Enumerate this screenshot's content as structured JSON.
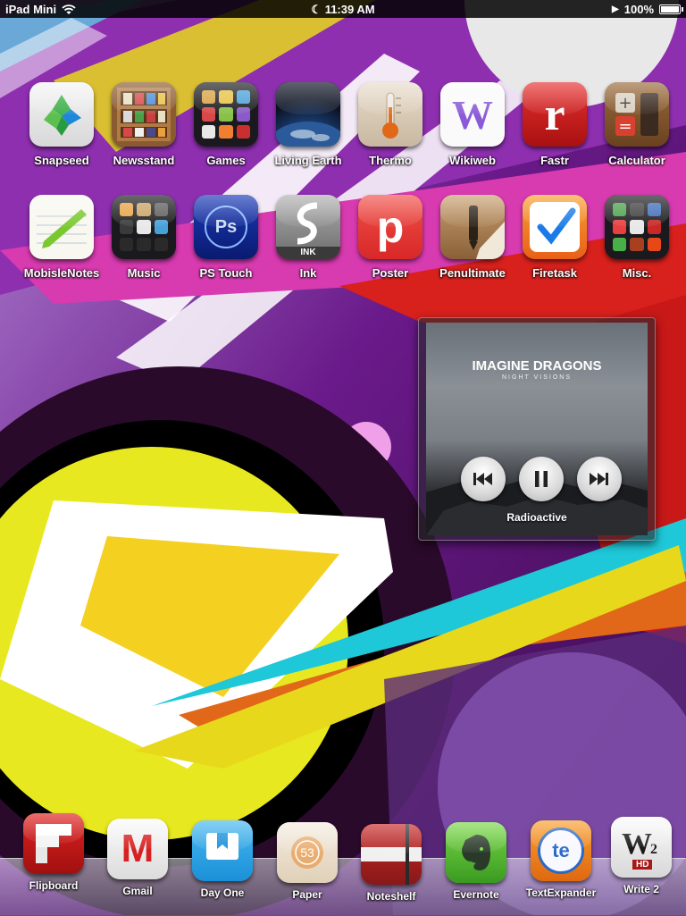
{
  "status_bar": {
    "device": "iPad Mini",
    "time": "11:39 AM",
    "battery": "100%"
  },
  "home_row1": [
    {
      "label": "Snapseed",
      "icon": "snapseed-icon"
    },
    {
      "label": "Newsstand",
      "icon": "newsstand-icon"
    },
    {
      "label": "Games",
      "icon": "games-folder-icon"
    },
    {
      "label": "Living Earth",
      "icon": "living-earth-icon"
    },
    {
      "label": "Thermo",
      "icon": "thermo-icon"
    },
    {
      "label": "Wikiweb",
      "icon": "wikiweb-icon"
    },
    {
      "label": "Fastr",
      "icon": "fastr-icon"
    },
    {
      "label": "Calculator",
      "icon": "calculator-icon"
    }
  ],
  "home_row2": [
    {
      "label": "MobisleNotes",
      "icon": "mobislenotes-icon"
    },
    {
      "label": "Music",
      "icon": "music-folder-icon"
    },
    {
      "label": "PS Touch",
      "icon": "ps-touch-icon"
    },
    {
      "label": "Ink",
      "icon": "ink-icon"
    },
    {
      "label": "Poster",
      "icon": "poster-icon"
    },
    {
      "label": "Penultimate",
      "icon": "penultimate-icon"
    },
    {
      "label": "Firetask",
      "icon": "firetask-icon"
    },
    {
      "label": "Misc.",
      "icon": "misc-folder-icon"
    }
  ],
  "glyphs": {
    "newsstand": "",
    "ps": "Ps",
    "ink": "INK",
    "poster": "p",
    "fastr": "r",
    "wikiweb": "W",
    "day_one": "",
    "paper": "53",
    "flipboard": "f",
    "gmail": "M",
    "textexpander": "te",
    "write2": "W",
    "write2_sub": "2",
    "write2_hd": "HD"
  },
  "player": {
    "band": "IMAGINE DRAGONS",
    "album": "NIGHT VISIONS",
    "song": "Radioactive",
    "prev_icon": "previous-track-icon",
    "pause_icon": "pause-icon",
    "next_icon": "next-track-icon"
  },
  "dock": [
    {
      "label": "Flipboard",
      "icon": "flipboard-icon"
    },
    {
      "label": "Gmail",
      "icon": "gmail-icon"
    },
    {
      "label": "Day One",
      "icon": "day-one-icon"
    },
    {
      "label": "Paper",
      "icon": "paper-icon"
    },
    {
      "label": "Noteshelf",
      "icon": "noteshelf-icon"
    },
    {
      "label": "Evernote",
      "icon": "evernote-icon"
    },
    {
      "label": "TextExpander",
      "icon": "textexpander-icon"
    },
    {
      "label": "Write 2",
      "icon": "write2-icon"
    }
  ],
  "colors": {
    "purple": "#8a2aa8",
    "magenta": "#d43aa8",
    "yellow": "#e8d81c",
    "cyan": "#1ec8d8",
    "red": "#d8201c"
  }
}
